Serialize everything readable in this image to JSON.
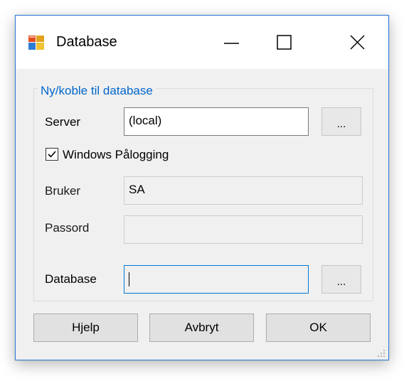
{
  "window": {
    "title": "Database",
    "accent_color": "#2b79d7"
  },
  "titlebar_buttons": {
    "minimize_icon": "minimize-icon",
    "maximize_icon": "maximize-icon",
    "close_icon": "close-icon"
  },
  "group": {
    "label": "Ny/koble til database",
    "label_color": "#0066cc"
  },
  "server": {
    "label": "Server",
    "value": "(local)",
    "browse_label": "..."
  },
  "windows_login": {
    "label": "Windows Pålogging",
    "checked": true
  },
  "user": {
    "label": "Bruker",
    "value": "SA"
  },
  "password": {
    "label": "Passord",
    "value": ""
  },
  "database": {
    "label": "Database",
    "value": "",
    "browse_label": "..."
  },
  "buttons": {
    "help": "Hjelp",
    "cancel": "Avbryt",
    "ok": "OK"
  }
}
